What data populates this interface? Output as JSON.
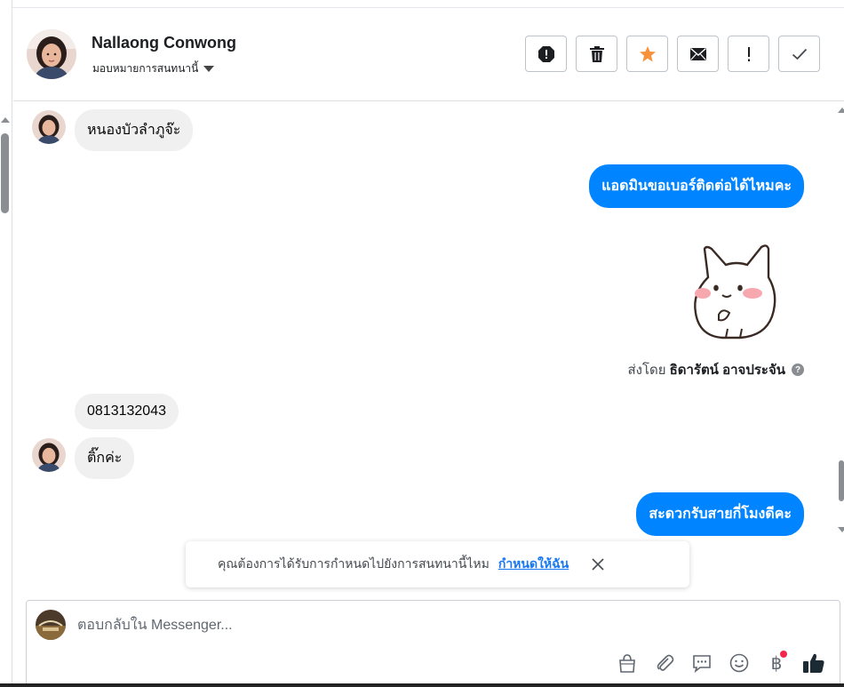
{
  "header": {
    "contact_name": "Nallaong Conwong",
    "assign_label": "มอบหมายการสนทนานี้",
    "actions": [
      {
        "icon": "spam-icon"
      },
      {
        "icon": "trash-icon"
      },
      {
        "icon": "star-icon"
      },
      {
        "icon": "mail-icon"
      },
      {
        "icon": "exclamation-icon"
      },
      {
        "icon": "check-icon"
      }
    ]
  },
  "messages": {
    "m1": "หนองบัวลำภูจ๊ะ",
    "m2": "แอดมินขอเบอร์ติดต่อได้ไหมคะ",
    "sticker": "cat-sticker",
    "sent_by_prefix": "ส่งโดย",
    "sent_by_name": "ธิดารัตน์ อาจประจัน",
    "m3": "0813132043",
    "m4": "ติ๊กค่ะ",
    "m5": "สะดวกรับสายกี่โมงดีคะ"
  },
  "toast": {
    "text": "คุณต้องการได้รับการกำหนดไปยังการสนทนานี้ไหม",
    "link": "กำหนดให้ฉัน"
  },
  "composer": {
    "placeholder": "ตอบกลับใน Messenger...",
    "tools": [
      "bag-icon",
      "paperclip-icon",
      "saved-replies-icon",
      "emoji-icon",
      "baht-icon",
      "thumbs-up-icon"
    ],
    "baht_symbol": "฿"
  },
  "colors": {
    "outgoing": "#0084ff",
    "incoming": "#f0f0f0",
    "star": "#f7923a",
    "like": "#1c2b33",
    "link": "#1877f2"
  }
}
